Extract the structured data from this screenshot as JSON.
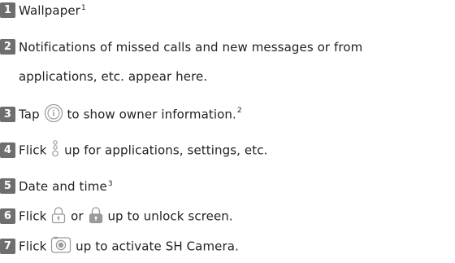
{
  "items": [
    {
      "num": "1",
      "text": "Wallpaper",
      "note": "1"
    },
    {
      "num": "2",
      "line1": "Notifications of missed calls and new messages or from",
      "line2": "applications, etc. appear here."
    },
    {
      "num": "3",
      "pre": "Tap",
      "icon": "info-circle-icon",
      "post": "to show owner information.",
      "note": "2"
    },
    {
      "num": "4",
      "pre": "Flick",
      "icon": "vertical-dots-handle-icon",
      "post": "up for applications, settings, etc."
    },
    {
      "num": "5",
      "text": "Date and time",
      "note": "3"
    },
    {
      "num": "6",
      "pre": "Flick",
      "icon": "lock-icon",
      "mid": "or",
      "icon2": "lock-icon",
      "post": "up to unlock screen."
    },
    {
      "num": "7",
      "pre": "Flick",
      "icon": "camera-icon",
      "post": "up to activate SH Camera."
    }
  ],
  "colors": {
    "number_badge": "#6e6e6e",
    "text": "#222222",
    "icon": "#9a9a9a"
  }
}
